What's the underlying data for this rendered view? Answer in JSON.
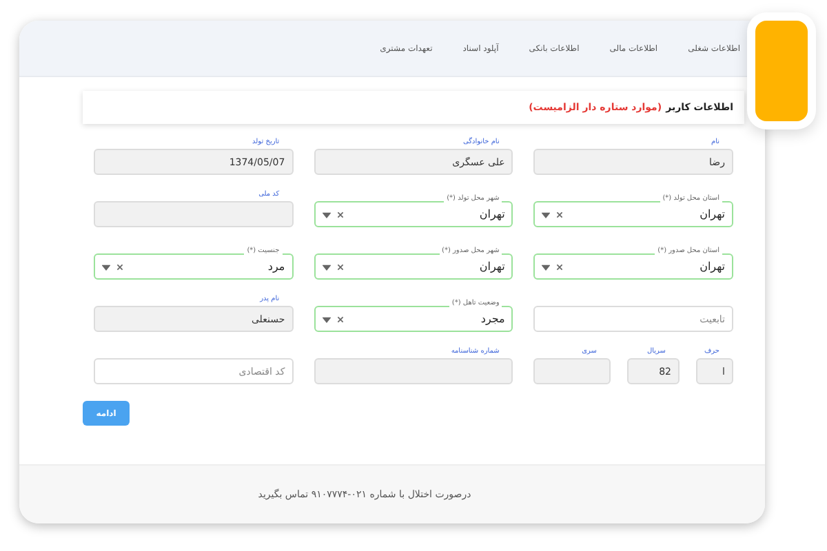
{
  "tabs": [
    {
      "label": "اطلاعات شغلی",
      "selected": false
    },
    {
      "label": "اطلاعات مالی",
      "selected": false
    },
    {
      "label": "اطلاعات بانکی",
      "selected": false
    },
    {
      "label": "آپلود اسناد",
      "selected": false
    },
    {
      "label": "تعهدات مشتری",
      "selected": false
    }
  ],
  "form": {
    "title": "اطلاعات کاربر",
    "note": "(موارد ستاره دار الزامیست)",
    "rows": [
      {
        "fields": [
          {
            "kind": "text",
            "label": "نام",
            "value": "رضا",
            "disabled": true
          },
          {
            "kind": "text",
            "label": "نام خانوادگی",
            "value": "علی عسگری",
            "disabled": true
          },
          {
            "kind": "text",
            "label": "تاریخ تولد",
            "value": "1374/05/07",
            "disabled": true
          }
        ]
      },
      {
        "fields": [
          {
            "kind": "select",
            "label": "استان محل تولد (*)",
            "value": "تهران"
          },
          {
            "kind": "select",
            "label": "شهر محل تولد (*)",
            "value": "تهران"
          },
          {
            "kind": "text",
            "label": "کد ملی",
            "disabled": true
          }
        ]
      },
      {
        "fields": [
          {
            "kind": "select",
            "label": "استان محل صدور (*)",
            "value": "تهران"
          },
          {
            "kind": "select",
            "label": "شهر محل صدور (*)",
            "value": "تهران"
          },
          {
            "kind": "select",
            "label": "جنسیت (*)",
            "value": "مرد"
          }
        ]
      },
      {
        "fields": [
          {
            "kind": "text",
            "placeholder": "تابعیت",
            "disabled": false
          },
          {
            "kind": "select",
            "label": "وضعیت تاهل (*)",
            "value": "مجرد"
          },
          {
            "kind": "text",
            "label": "نام پدر",
            "value": "حسنعلی",
            "disabled": true
          }
        ]
      },
      {
        "fields": [
          {
            "kind": "group",
            "fields": [
              {
                "kind": "text",
                "label": "حرف",
                "value": "ا",
                "disabled": true
              },
              {
                "kind": "text",
                "label": "سریال",
                "value": "82",
                "disabled": true
              },
              {
                "kind": "text",
                "label": "سری",
                "disabled": true
              }
            ]
          },
          {
            "kind": "text",
            "label": "شماره شناسنامه",
            "disabled": true
          },
          {
            "kind": "text",
            "placeholder": "کد اقتصادی",
            "disabled": false
          }
        ]
      }
    ],
    "submit": "ادامه"
  },
  "footer": "درصورت اختلال با شماره ۰۲۱-۹۱۰۷۷۷۴ تماس بگیرید"
}
